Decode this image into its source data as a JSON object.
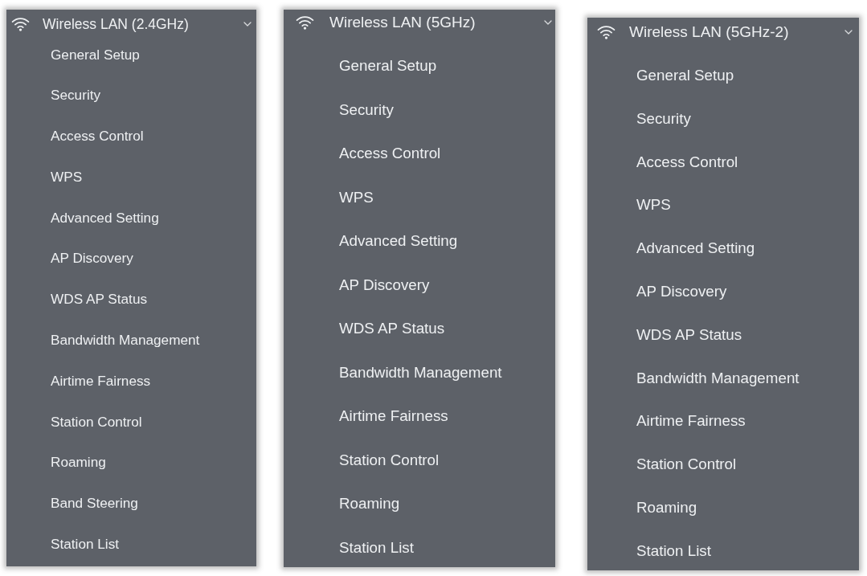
{
  "panels": [
    {
      "title": "Wireless LAN (2.4GHz)",
      "expanded": true,
      "items": [
        "General Setup",
        "Security",
        "Access Control",
        "WPS",
        "Advanced Setting",
        "AP Discovery",
        "WDS AP Status",
        "Bandwidth Management",
        "Airtime Fairness",
        "Station Control",
        "Roaming",
        "Band Steering",
        "Station List"
      ]
    },
    {
      "title": "Wireless LAN (5GHz)",
      "expanded": true,
      "items": [
        "General Setup",
        "Security",
        "Access Control",
        "WPS",
        "Advanced Setting",
        "AP Discovery",
        "WDS AP Status",
        "Bandwidth Management",
        "Airtime Fairness",
        "Station Control",
        "Roaming",
        "Station List"
      ]
    },
    {
      "title": "Wireless LAN (5GHz-2)",
      "expanded": true,
      "items": [
        "General Setup",
        "Security",
        "Access Control",
        "WPS",
        "Advanced Setting",
        "AP Discovery",
        "WDS AP Status",
        "Bandwidth Management",
        "Airtime Fairness",
        "Station Control",
        "Roaming",
        "Station List"
      ]
    }
  ]
}
